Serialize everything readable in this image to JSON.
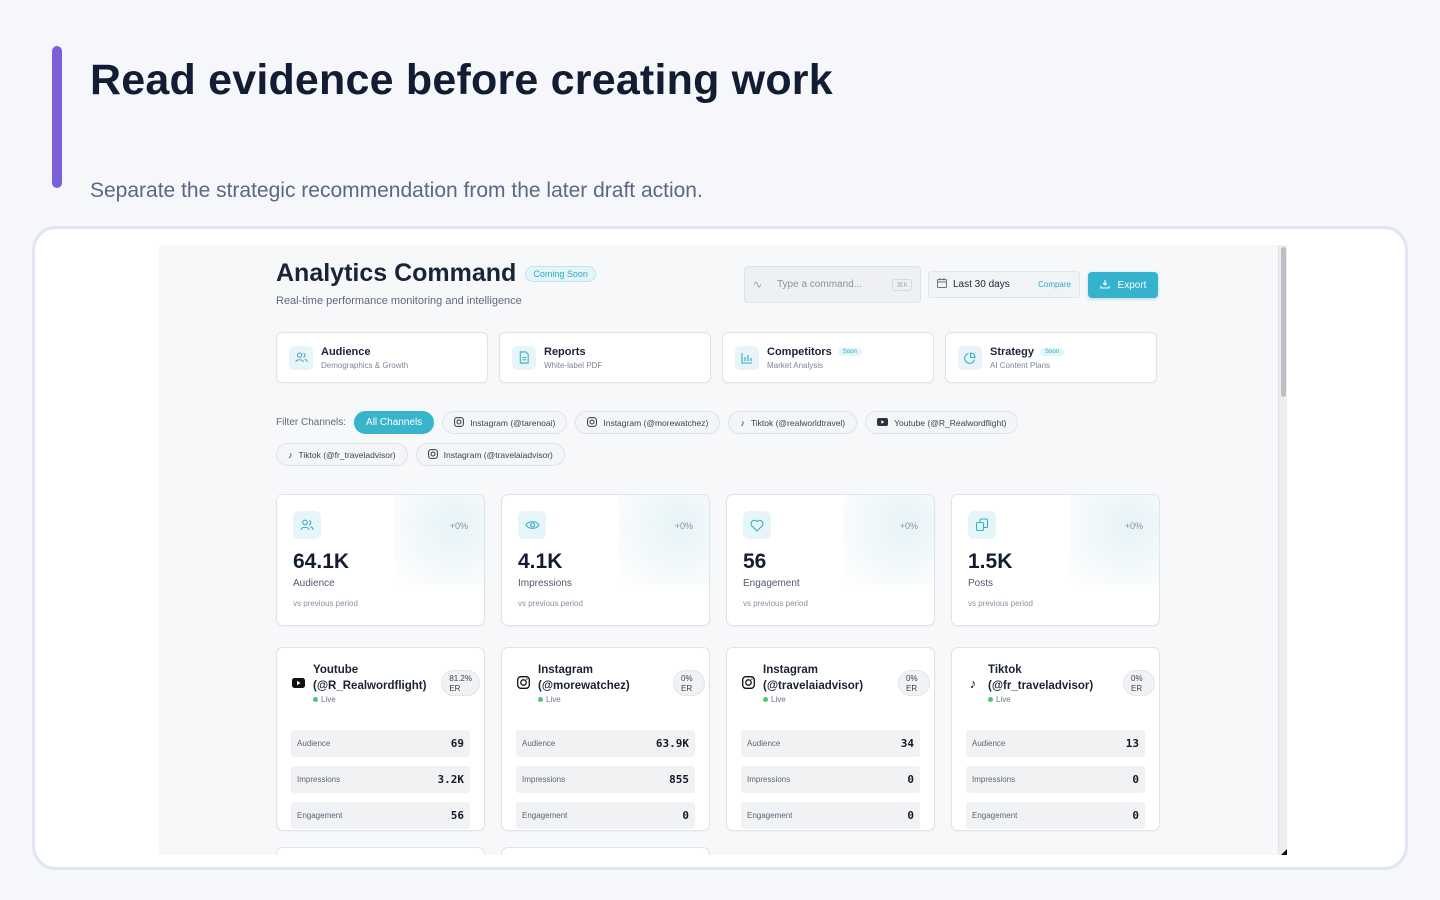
{
  "slide": {
    "headline": "Read evidence before creating work",
    "subline": "Separate the strategic recommendation from the later draft action."
  },
  "app": {
    "title": "Analytics Command",
    "title_badge": "Coming Soon",
    "subtitle": "Real-time performance monitoring and intelligence",
    "command": {
      "placeholder": "Type a command...",
      "shortcut": "⌘K"
    },
    "date_range": {
      "label": "Last 30 days",
      "compare": "Compare"
    },
    "export_label": "Export"
  },
  "nav_cards": [
    {
      "title": "Audience",
      "subtitle": "Demographics & Growth",
      "badge": "",
      "icon": "users-icon"
    },
    {
      "title": "Reports",
      "subtitle": "White-label PDF",
      "badge": "",
      "icon": "document-icon"
    },
    {
      "title": "Competitors",
      "subtitle": "Market Analysis",
      "badge": "Soon",
      "icon": "bar-chart-icon"
    },
    {
      "title": "Strategy",
      "subtitle": "AI Content Plans",
      "badge": "Soon",
      "icon": "pie-chart-icon"
    }
  ],
  "filters": {
    "label": "Filter Channels:",
    "chips": [
      {
        "label": "All Channels",
        "active": true,
        "icon": ""
      },
      {
        "label": "Instagram (@tarenoai)",
        "icon": "instagram-icon"
      },
      {
        "label": "Instagram (@morewatchez)",
        "icon": "instagram-icon"
      },
      {
        "label": "Tiktok (@realworldtravel)",
        "icon": "tiktok-icon"
      },
      {
        "label": "Youtube (@R_Realwordflight)",
        "icon": "youtube-icon"
      },
      {
        "label": "Tiktok (@fr_traveladvisor)",
        "icon": "tiktok-icon"
      },
      {
        "label": "Instagram (@travelaiadvisor)",
        "icon": "instagram-icon"
      }
    ]
  },
  "metrics": [
    {
      "value": "64.1K",
      "label": "Audience",
      "delta": "+0%",
      "foot": "vs previous period",
      "icon": "users-icon"
    },
    {
      "value": "4.1K",
      "label": "Impressions",
      "delta": "+0%",
      "foot": "vs previous period",
      "icon": "eye-icon"
    },
    {
      "value": "56",
      "label": "Engagement",
      "delta": "+0%",
      "foot": "vs previous period",
      "icon": "heart-icon"
    },
    {
      "value": "1.5K",
      "label": "Posts",
      "delta": "+0%",
      "foot": "vs previous period",
      "icon": "copy-icon"
    }
  ],
  "channels": [
    {
      "name": "Youtube (@R_Realwordflight)",
      "status": "Live",
      "er_value": "81.2%",
      "er_label": "ER",
      "icon": "youtube-icon",
      "rows": [
        {
          "label": "Audience",
          "value": "69"
        },
        {
          "label": "Impressions",
          "value": "3.2K"
        },
        {
          "label": "Engagement",
          "value": "56"
        }
      ]
    },
    {
      "name": "Instagram (@morewatchez)",
      "status": "Live",
      "er_value": "0%",
      "er_label": "ER",
      "icon": "instagram-icon",
      "rows": [
        {
          "label": "Audience",
          "value": "63.9K"
        },
        {
          "label": "Impressions",
          "value": "855"
        },
        {
          "label": "Engagement",
          "value": "0"
        }
      ]
    },
    {
      "name": "Instagram (@travelaiadvisor)",
      "status": "Live",
      "er_value": "0%",
      "er_label": "ER",
      "icon": "instagram-icon",
      "rows": [
        {
          "label": "Audience",
          "value": "34"
        },
        {
          "label": "Impressions",
          "value": "0"
        },
        {
          "label": "Engagement",
          "value": "0"
        }
      ]
    },
    {
      "name": "Tiktok (@fr_traveladvisor)",
      "status": "Live",
      "er_value": "0%",
      "er_label": "ER",
      "icon": "tiktok-icon",
      "rows": [
        {
          "label": "Audience",
          "value": "13"
        },
        {
          "label": "Impressions",
          "value": "0"
        },
        {
          "label": "Engagement",
          "value": "0"
        }
      ]
    }
  ],
  "colors": {
    "accent": "#38b4cd",
    "slide_bar": "#7b61d9",
    "live": "#4cc47a"
  }
}
